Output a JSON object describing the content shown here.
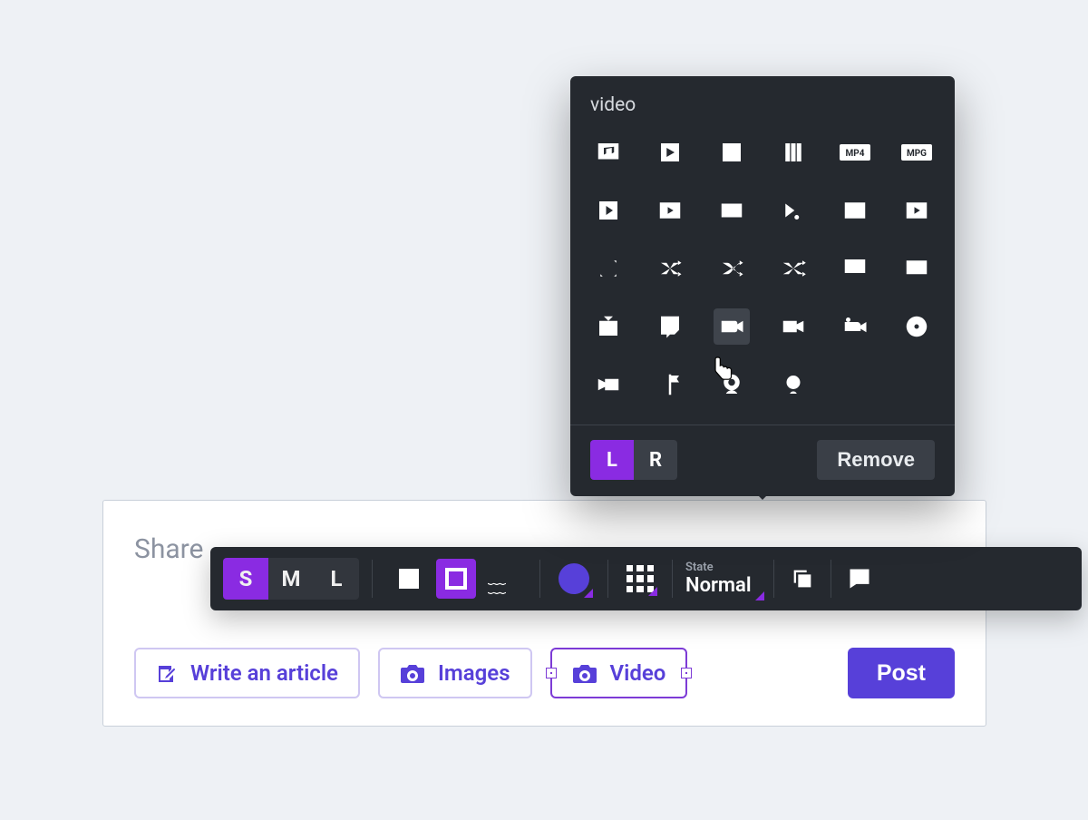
{
  "card": {
    "placeholder": "Share"
  },
  "buttons": {
    "write": {
      "label": "Write an article"
    },
    "images": {
      "label": "Images"
    },
    "video": {
      "label": "Video",
      "selected": true
    },
    "post": {
      "label": "Post"
    }
  },
  "toolbar": {
    "sizes": {
      "s": "S",
      "m": "M",
      "l": "L",
      "active": "S"
    },
    "state": {
      "label": "State",
      "value": "Normal"
    }
  },
  "popover": {
    "title": "video",
    "align": {
      "l": "L",
      "r": "R",
      "active": "L"
    },
    "remove": "Remove",
    "selected_index": 20,
    "icons": [
      "music-note",
      "play-solid",
      "film",
      "film-columns",
      "mp4-badge",
      "mpg-badge",
      "play-square",
      "play-square-alt",
      "filmstrip",
      "play-forward",
      "video-frame",
      "video-frame-play",
      "shuffle-x",
      "shuffle-1",
      "shuffle-2",
      "shuffle-3",
      "desktop",
      "monitor",
      "tv-retro",
      "twitch",
      "video-camera",
      "camcorder",
      "video-camera-alt",
      "disc",
      "camcorder-left",
      "flag-pin",
      "webcam",
      "webcam-alt"
    ]
  },
  "colors": {
    "primary": "#5740d9",
    "accent": "#8a2be2",
    "toolbar": "#25292f"
  }
}
